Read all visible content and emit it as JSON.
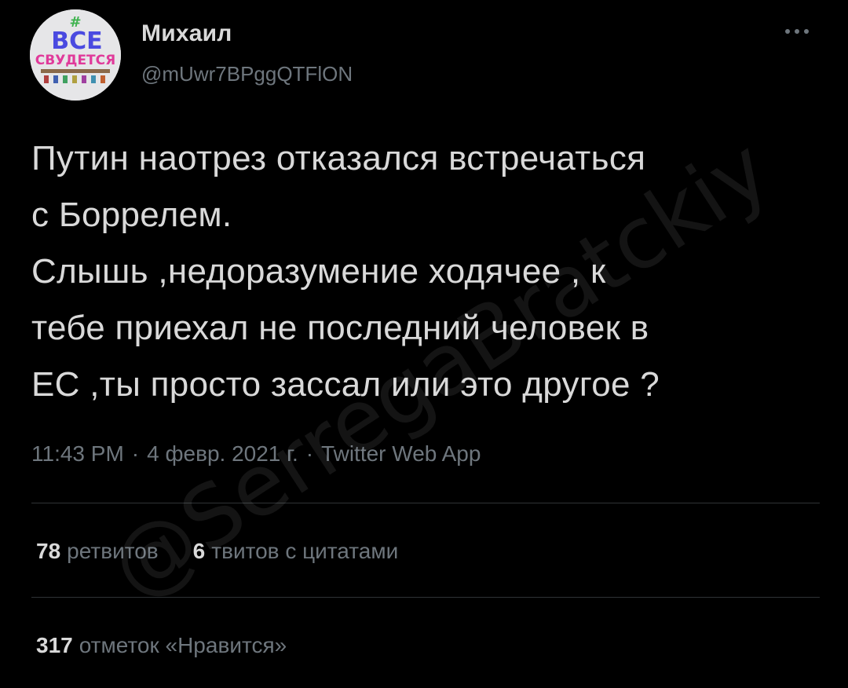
{
  "author": {
    "name": "Михаил",
    "handle": "@mUwr7BPggQTFlON",
    "avatar_text": [
      "#",
      "ВСЕ",
      "СВУДЕТСЯ"
    ]
  },
  "menu_icon": "more-horizontal-icon",
  "tweet": {
    "text": "Путин наотрез отказался встречаться\nс Боррелем.\nСлышь ,недоразумение ходячее , к\nтебе приехал не последний человек в\nЕС ,ты просто зассал или это другое ?"
  },
  "meta": {
    "time": "11:43 PM",
    "date": "4 февр. 2021 г.",
    "source": "Twitter Web App",
    "separator": "·"
  },
  "stats": {
    "retweets_count": "78",
    "retweets_label": "ретвитов",
    "quotes_count": "6",
    "quotes_label": "твитов с цитатами",
    "likes_count": "317",
    "likes_label": "отметок «Нравится»"
  },
  "watermark": "@SerregaBratckiy",
  "colors": {
    "background": "#000000",
    "text": "#d9d9d9",
    "secondary": "#6e767d",
    "divider": "#2f3336"
  }
}
